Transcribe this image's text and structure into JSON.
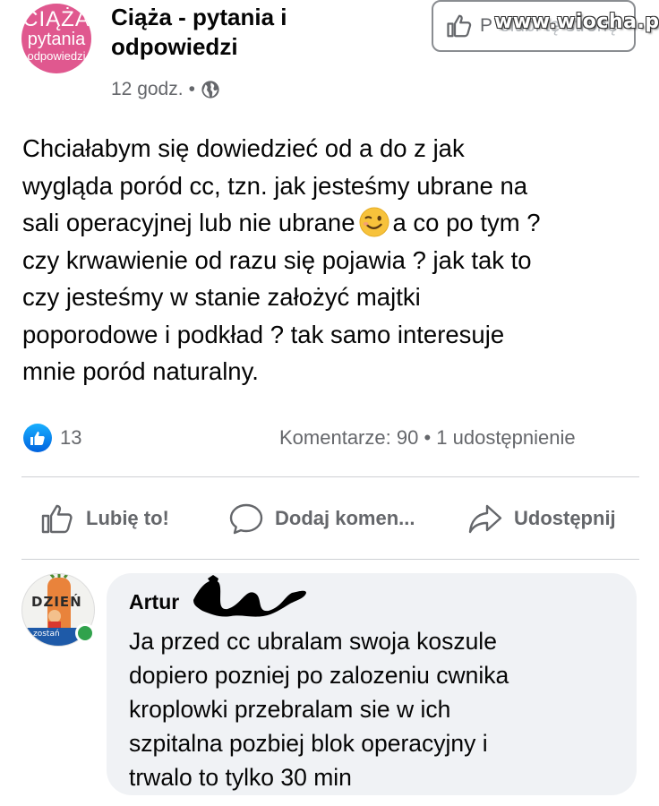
{
  "header": {
    "group_avatar": {
      "line1": "CIĄŻA",
      "line2": "pytania",
      "line3": "odpowiedzi"
    },
    "group_name": "Ciąża - pytania i odpowiedzi",
    "time": "12 godz.",
    "separator": "•",
    "privacy_icon": "globe-icon",
    "follow_button": {
      "icon": "thumbs-up-icon",
      "label_visible": "P",
      "label_faded": "olubi tę stronę"
    },
    "watermark": "www.wiocha.pl"
  },
  "post": {
    "lines": [
      "Chciałabym się dowiedzieć od a do z jak",
      "wygląda poród cc, tzn. jak jesteśmy ubrane na",
      "sali operacyjnej lub nie ubrane",
      "czy krwawienie od razu się pojawia ? jak tak to",
      "czy jesteśmy w stanie założyć majtki",
      "poporodowe i podkład ? tak samo interesuje",
      "mnie poród naturalny."
    ],
    "line3_after_emoji": "a co po tym ?",
    "emoji": "winking-face-emoji"
  },
  "stats": {
    "likes": "13",
    "comments": "Komentarze: 90",
    "separator": "•",
    "shares": "1 udostępnienie"
  },
  "actions": {
    "like": "Lubię to!",
    "comment": "Dodaj komen...",
    "share": "Udostępnij"
  },
  "comment": {
    "author": "Artur",
    "avatar_text": "DZIEŃ",
    "avatar_caption": "zostań",
    "lines": [
      "Ja przed cc ubralam swoja koszule",
      "dopiero pozniej po zalozeniu cwnika",
      "kroplowki przebralam sie w ich",
      "szpitalna pozbiej blok operacyjny i",
      "trwalo to tylko 30 min"
    ]
  },
  "colors": {
    "text": "#050505",
    "secondary": "#65676b",
    "facebook_blue": "#1877f2",
    "divider": "#ced0d4",
    "bubble": "#f0f2f5",
    "online": "#31a24c",
    "group_pink": "#e0588f"
  }
}
